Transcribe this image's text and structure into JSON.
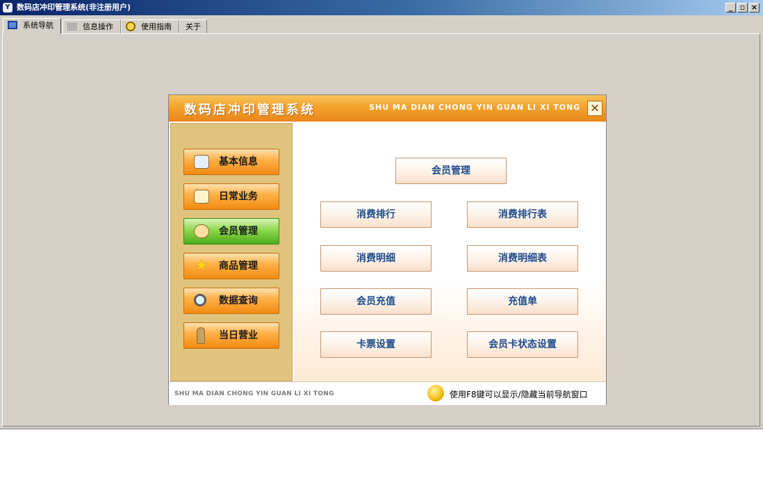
{
  "window": {
    "title": "数码店冲印管理系统(非注册用户)",
    "controls": {
      "minimize": "_",
      "restore": "▫",
      "close": "×"
    }
  },
  "tabs": [
    {
      "label": "系统导航",
      "icon": "monitor-icon",
      "active": true
    },
    {
      "label": "信息操作",
      "icon": "grid-icon",
      "active": false
    },
    {
      "label": "使用指南",
      "icon": "help-icon",
      "active": false
    },
    {
      "label": "关于",
      "icon": "",
      "active": false
    }
  ],
  "navigator": {
    "title": "数码店冲印管理系统",
    "subtitle": "SHU MA DIAN CHONG YIN GUAN LI XI TONG",
    "close_label": "✕",
    "sidebar": [
      {
        "label": "基本信息",
        "icon": "id-card-icon",
        "active": false
      },
      {
        "label": "日常业务",
        "icon": "document-icon",
        "active": false
      },
      {
        "label": "会员管理",
        "icon": "users-icon",
        "active": true
      },
      {
        "label": "商品管理",
        "icon": "star-icon",
        "active": false
      },
      {
        "label": "数据查询",
        "icon": "magnifier-icon",
        "active": false
      },
      {
        "label": "当日营业",
        "icon": "person-icon",
        "active": false
      }
    ],
    "functions": {
      "top": "会员管理",
      "rows": [
        [
          "消费排行",
          "消费排行表"
        ],
        [
          "消费明细",
          "消费明细表"
        ],
        [
          "会员充值",
          "充值单"
        ],
        [
          "卡票设置",
          "会员卡状态设置"
        ]
      ]
    },
    "footer": {
      "left": "SHU MA DIAN CHONG YIN GUAN LI XI TONG",
      "hint": "使用F8键可以显示/隐藏当前导航窗口",
      "hint_icon": "lightbulb-icon"
    }
  },
  "colors": {
    "titlebar_start": "#0a246a",
    "header_orange": "#f4a32c",
    "sidebar_bg": "#e0c47d",
    "active_green": "#4cab1a",
    "function_text": "#1c4a8c"
  }
}
